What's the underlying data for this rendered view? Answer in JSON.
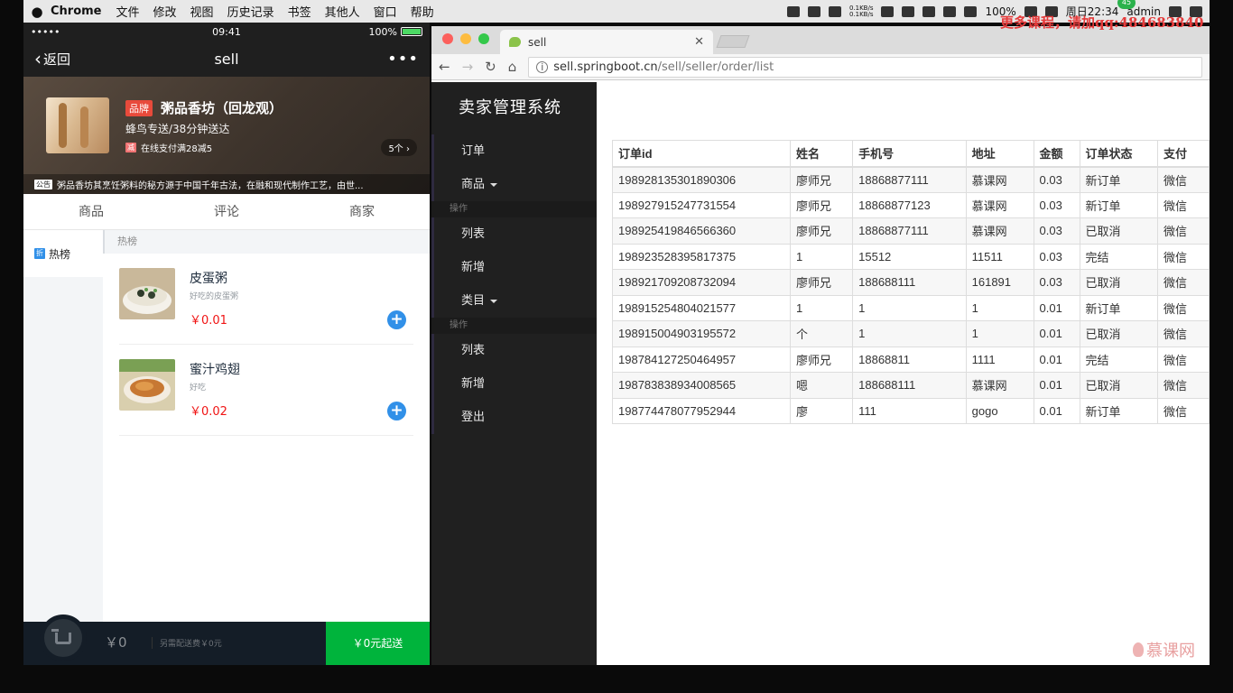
{
  "menubar": {
    "app": "Chrome",
    "menus": [
      "文件",
      "修改",
      "视图",
      "历史记录",
      "书签",
      "其他人",
      "窗口",
      "帮助"
    ],
    "net_up": "0.1KB/s",
    "net_down": "0.1KB/s",
    "battery": "100%",
    "clock": "周日22:34",
    "user": "admin",
    "badge": "45"
  },
  "overlay": {
    "promo": "更多课程，请加qq:484683840"
  },
  "phone": {
    "status": {
      "carrier": "•••••",
      "time": "09:41",
      "battery": "100%"
    },
    "nav": {
      "back": "返回",
      "title": "sell"
    },
    "shop": {
      "brand_tag": "品牌",
      "name": "粥品香坊（回龙观）",
      "delivery": "蜂鸟专送/38分钟送达",
      "promo_tag": "减",
      "promo": "在线支付满28减5",
      "count": "5个",
      "notice_tag": "公告",
      "notice": "粥品香坊其烹饪粥料的秘方源于中国千年古法，在融和现代制作工艺，由世..."
    },
    "tabs": [
      "商品",
      "评论",
      "商家"
    ],
    "category": {
      "tag": "折",
      "label": "热榜"
    },
    "section_title": "热榜",
    "foods": [
      {
        "name": "皮蛋粥",
        "desc": "好吃的皮蛋粥",
        "price": "￥0.01"
      },
      {
        "name": "蜜汁鸡翅",
        "desc": "好吃",
        "price": "￥0.02"
      }
    ],
    "cart": {
      "price": "￥0",
      "note": "另需配送费￥0元",
      "pay": "￥0元起送"
    }
  },
  "browser": {
    "tab_title": "sell",
    "url_host": "sell.springboot.cn",
    "url_path": "/sell/seller/order/list"
  },
  "sidebar": {
    "title": "卖家管理系统",
    "items": [
      {
        "label": "订单"
      },
      {
        "label": "商品",
        "dropdown": true
      },
      {
        "header": "操作"
      },
      {
        "label": "列表"
      },
      {
        "label": "新增"
      },
      {
        "label": "类目",
        "dropdown": true
      },
      {
        "header": "操作"
      },
      {
        "label": "列表"
      },
      {
        "label": "新增"
      },
      {
        "label": "登出"
      }
    ]
  },
  "orders": {
    "columns": [
      "订单id",
      "姓名",
      "手机号",
      "地址",
      "金额",
      "订单状态",
      "支付"
    ],
    "rows": [
      [
        "198928135301890306",
        "廖师兄",
        "18868877111",
        "慕课网",
        "0.03",
        "新订单",
        "微信"
      ],
      [
        "198927915247731554",
        "廖师兄",
        "18868877123",
        "慕课网",
        "0.03",
        "新订单",
        "微信"
      ],
      [
        "198925419846566360",
        "廖师兄",
        "18868877111",
        "慕课网",
        "0.03",
        "已取消",
        "微信"
      ],
      [
        "198923528395817375",
        "1",
        "15512",
        "11511",
        "0.03",
        "完结",
        "微信"
      ],
      [
        "198921709208732094",
        "廖师兄",
        "188688111",
        "161891",
        "0.03",
        "已取消",
        "微信"
      ],
      [
        "198915254804021577",
        "1",
        "1",
        "1",
        "0.01",
        "新订单",
        "微信"
      ],
      [
        "198915004903195572",
        "个",
        "1",
        "1",
        "0.01",
        "已取消",
        "微信"
      ],
      [
        "198784127250464957",
        "廖师兄",
        "18868811",
        "1111",
        "0.01",
        "完结",
        "微信"
      ],
      [
        "198783838934008565",
        "嗯",
        "188688111",
        "慕课网",
        "0.01",
        "已取消",
        "微信"
      ],
      [
        "198774478077952944",
        "廖",
        "111",
        "gogo",
        "0.01",
        "新订单",
        "微信"
      ]
    ]
  },
  "watermark": "慕课网"
}
